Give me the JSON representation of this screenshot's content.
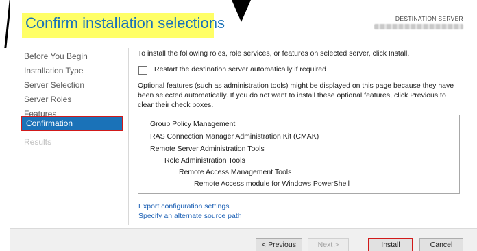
{
  "header": {
    "title": "Confirm installation selections",
    "destination_label": "DESTINATION SERVER",
    "destination_value": ""
  },
  "nav": {
    "items": [
      {
        "label": "Before You Begin",
        "state": "normal"
      },
      {
        "label": "Installation Type",
        "state": "normal"
      },
      {
        "label": "Server Selection",
        "state": "normal"
      },
      {
        "label": "Server Roles",
        "state": "normal"
      },
      {
        "label": "Features",
        "state": "normal"
      },
      {
        "label": "Confirmation",
        "state": "selected"
      },
      {
        "label": "Results",
        "state": "disabled"
      }
    ]
  },
  "content": {
    "intro": "To install the following roles, role services, or features on selected server, click Install.",
    "restart_label": "Restart the destination server automatically if required",
    "restart_checked": false,
    "optional_note": "Optional features (such as administration tools) might be displayed on this page because they have been selected automatically. If you do not want to install these optional features, click Previous to clear their check boxes.",
    "features": [
      {
        "label": "Group Policy Management",
        "indent": 0
      },
      {
        "label": "RAS Connection Manager Administration Kit (CMAK)",
        "indent": 0
      },
      {
        "label": "Remote Server Administration Tools",
        "indent": 0
      },
      {
        "label": "Role Administration Tools",
        "indent": 1
      },
      {
        "label": "Remote Access Management Tools",
        "indent": 2
      },
      {
        "label": "Remote Access module for Windows PowerShell",
        "indent": 3
      }
    ],
    "links": {
      "export": "Export configuration settings",
      "alternate_source": "Specify an alternate source path"
    }
  },
  "footer": {
    "previous": "< Previous",
    "next": "Next >",
    "install": "Install",
    "cancel": "Cancel"
  },
  "colors": {
    "accent": "#1a72b8",
    "highlight": "#ffff66",
    "annotation_red": "#d11a1a"
  }
}
